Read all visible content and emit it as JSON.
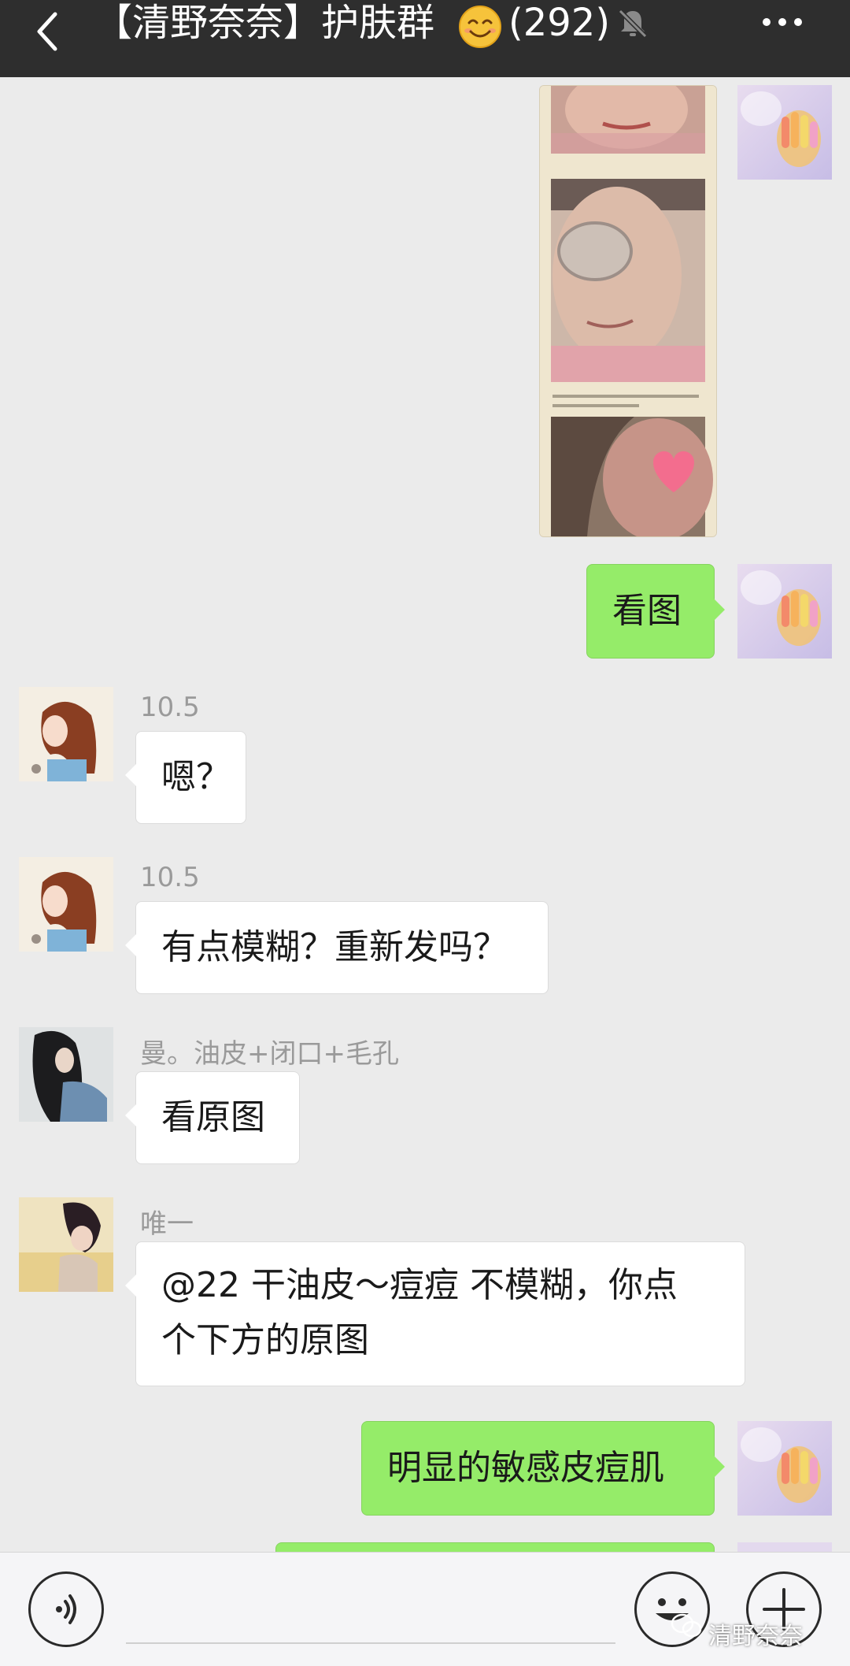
{
  "header": {
    "title": "【清野奈奈】护肤群",
    "member_count": "(292)",
    "back_icon": "chevron-left-icon",
    "mute_icon": "bell-muted-icon",
    "more_icon": "more-dots-icon"
  },
  "messages": [
    {
      "side": "right",
      "type": "image"
    },
    {
      "side": "right",
      "type": "text",
      "text": "看图"
    },
    {
      "side": "left",
      "sender": "10.5",
      "text": "嗯？"
    },
    {
      "side": "left",
      "sender": "10.5",
      "text": "有点模糊？重新发吗？"
    },
    {
      "side": "left",
      "sender": "曼。油皮+闭口+毛孔",
      "text": "看原图"
    },
    {
      "side": "left",
      "sender": "唯一",
      "text_line1": "@22 干油皮～痘痘  不模糊，你点",
      "text_line2": "个下方的原图"
    },
    {
      "side": "right",
      "type": "text",
      "text": "明显的敏感皮痘肌"
    }
  ],
  "input_bar": {
    "voice_icon": "voice-icon",
    "emoji_icon": "smiley-icon",
    "plus_icon": "plus-icon"
  },
  "watermark": "清野奈奈",
  "colors": {
    "top_bar": "#2e2e2e",
    "chat_background": "#ebebeb",
    "own_bubble": "#95ec69",
    "other_bubble": "#ffffff",
    "sender_name": "#9a9a9a"
  }
}
